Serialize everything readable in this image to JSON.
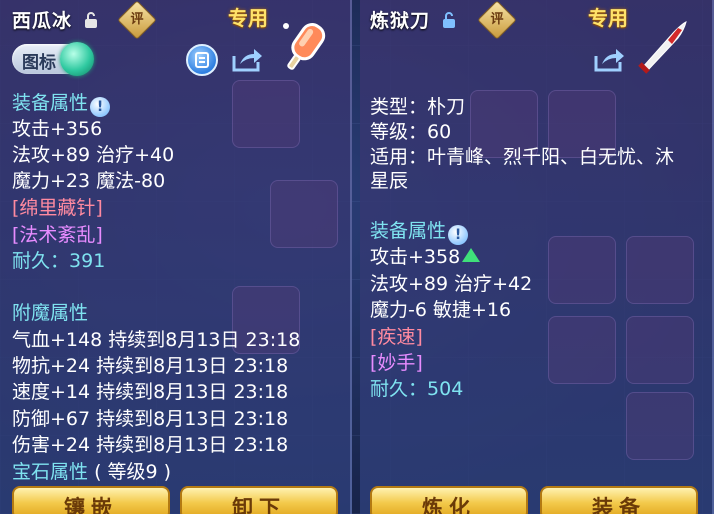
{
  "left": {
    "item_name": "西瓜冰",
    "eval_badge": "评",
    "exclusive_label": "专用",
    "icon_toggle_label": "图标",
    "icon_toggle_state": "on",
    "equip_section": "装备属性",
    "equip_stats": [
      "攻击+356",
      "法攻+89 治疗+40",
      "魔力+23 魔法-80"
    ],
    "special1": "[绵里藏针]",
    "special2": "[法术紊乱]",
    "durability_label": "耐久：",
    "durability_value": "391",
    "enchant_section": "附魔属性",
    "enchant_stats": [
      "气血+148 持续到8月13日 23:18",
      "物抗+24 持续到8月13日 23:18",
      "速度+14 持续到8月13日 23:18",
      "防御+67 持续到8月13日 23:18",
      "伤害+24 持续到8月13日 23:18"
    ],
    "gem_section": "宝石属性",
    "gem_level": "( 等级9 )",
    "buttons": [
      "镶嵌",
      "卸下"
    ]
  },
  "right": {
    "item_name": "炼狱刀",
    "eval_badge": "评",
    "exclusive_label": "专用",
    "type_line": "类型：朴刀",
    "level_line": "等级：60",
    "fit_line1": "适用：叶青峰、烈千阳、白无忧、沐",
    "fit_line2": "星辰",
    "equip_section": "装备属性",
    "equip_stats": [
      "攻击+358",
      "法攻+89 治疗+42",
      "魔力-6 敏捷+16"
    ],
    "special1": "[疾速]",
    "special2": "[妙手]",
    "durability_label": "耐久：",
    "durability_value": "504",
    "buttons": [
      "炼化",
      "装备"
    ]
  },
  "icons": [
    "lock-icon",
    "info-icon",
    "list-icon",
    "share-icon",
    "popsicle-icon",
    "blade-icon",
    "up-arrow-icon"
  ],
  "colors": {
    "section": "#7fe3f0",
    "special_red": "#ff8aa0",
    "special_purple": "#e78cff",
    "exclusive": "#ffe36b",
    "button": "#f3c94a"
  }
}
